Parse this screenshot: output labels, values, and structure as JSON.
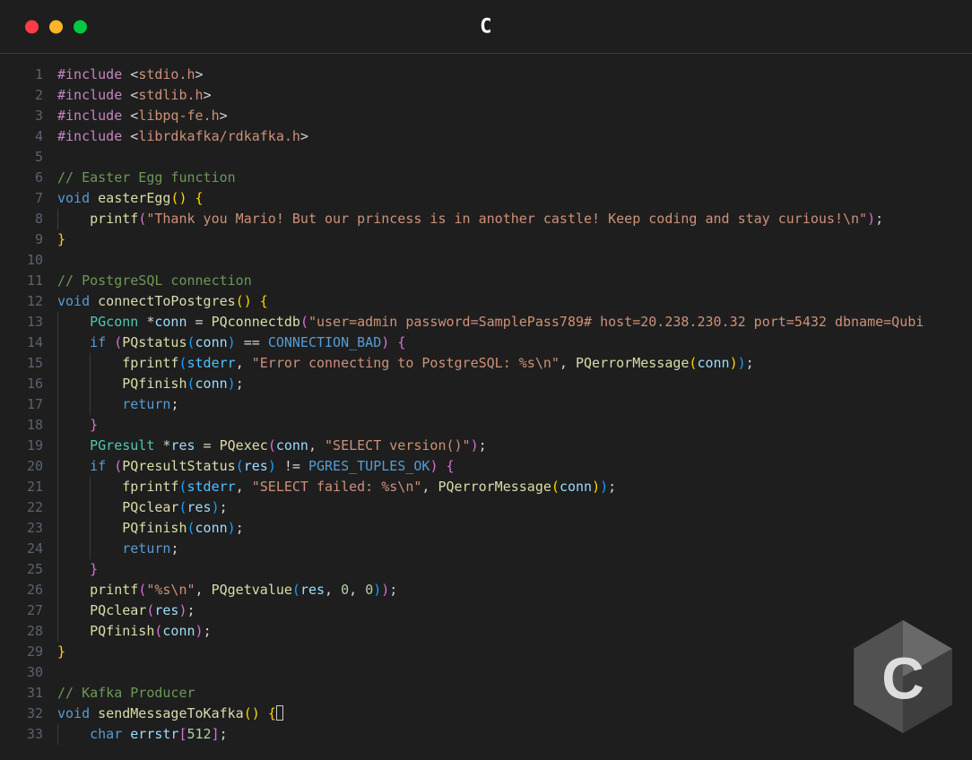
{
  "window": {
    "title": "C"
  },
  "traffic": {
    "close": "close",
    "min": "minimize",
    "max": "maximize"
  },
  "watermark": "c-language-logo",
  "code_lines": [
    {
      "n": 1,
      "t": [
        [
          "pre",
          "#include"
        ],
        [
          "pn",
          " <"
        ],
        [
          "str",
          "stdio.h"
        ],
        [
          "pn",
          ">"
        ]
      ]
    },
    {
      "n": 2,
      "t": [
        [
          "pre",
          "#include"
        ],
        [
          "pn",
          " <"
        ],
        [
          "str",
          "stdlib.h"
        ],
        [
          "pn",
          ">"
        ]
      ]
    },
    {
      "n": 3,
      "t": [
        [
          "pre",
          "#include"
        ],
        [
          "pn",
          " <"
        ],
        [
          "str",
          "libpq-fe.h"
        ],
        [
          "pn",
          ">"
        ]
      ]
    },
    {
      "n": 4,
      "t": [
        [
          "pre",
          "#include"
        ],
        [
          "pn",
          " <"
        ],
        [
          "str",
          "librdkafka/rdkafka.h"
        ],
        [
          "pn",
          ">"
        ]
      ]
    },
    {
      "n": 5,
      "t": []
    },
    {
      "n": 6,
      "t": [
        [
          "cmt",
          "// Easter Egg function"
        ]
      ]
    },
    {
      "n": 7,
      "t": [
        [
          "kw",
          "void"
        ],
        [
          "op",
          " "
        ],
        [
          "fn",
          "easterEgg"
        ],
        [
          "br1",
          "()"
        ],
        [
          "op",
          " "
        ],
        [
          "br1",
          "{"
        ]
      ]
    },
    {
      "n": 8,
      "indent": 1,
      "t": [
        [
          "fn",
          "printf"
        ],
        [
          "br2",
          "("
        ],
        [
          "str",
          "\"Thank you Mario! But our princess is in another castle! Keep coding and stay curious!\\n\""
        ],
        [
          "br2",
          ")"
        ],
        [
          "pn",
          ";"
        ]
      ]
    },
    {
      "n": 9,
      "t": [
        [
          "br1",
          "}"
        ]
      ]
    },
    {
      "n": 10,
      "t": []
    },
    {
      "n": 11,
      "t": [
        [
          "cmt",
          "// PostgreSQL connection"
        ]
      ]
    },
    {
      "n": 12,
      "t": [
        [
          "kw",
          "void"
        ],
        [
          "op",
          " "
        ],
        [
          "fn",
          "connectToPostgres"
        ],
        [
          "br1",
          "()"
        ],
        [
          "op",
          " "
        ],
        [
          "br1",
          "{"
        ]
      ]
    },
    {
      "n": 13,
      "indent": 1,
      "t": [
        [
          "type",
          "PGconn"
        ],
        [
          "op",
          " *"
        ],
        [
          "id",
          "conn"
        ],
        [
          "op",
          " = "
        ],
        [
          "fn",
          "PQconnectdb"
        ],
        [
          "br2",
          "("
        ],
        [
          "str",
          "\"user=admin password=SamplePass789# host=20.238.230.32 port=5432 dbname=Qubi"
        ]
      ]
    },
    {
      "n": 14,
      "indent": 1,
      "t": [
        [
          "kw",
          "if"
        ],
        [
          "op",
          " "
        ],
        [
          "br2",
          "("
        ],
        [
          "fn",
          "PQstatus"
        ],
        [
          "br3",
          "("
        ],
        [
          "id",
          "conn"
        ],
        [
          "br3",
          ")"
        ],
        [
          "op",
          " == "
        ],
        [
          "mac",
          "CONNECTION_BAD"
        ],
        [
          "br2",
          ")"
        ],
        [
          "op",
          " "
        ],
        [
          "br2",
          "{"
        ]
      ]
    },
    {
      "n": 15,
      "indent": 2,
      "t": [
        [
          "fn",
          "fprintf"
        ],
        [
          "br3",
          "("
        ],
        [
          "cnst",
          "stderr"
        ],
        [
          "pn",
          ", "
        ],
        [
          "str",
          "\"Error connecting to PostgreSQL: %s\\n\""
        ],
        [
          "pn",
          ", "
        ],
        [
          "fn",
          "PQerrorMessage"
        ],
        [
          "br1",
          "("
        ],
        [
          "id",
          "conn"
        ],
        [
          "br1",
          ")"
        ],
        [
          "br3",
          ")"
        ],
        [
          "pn",
          ";"
        ]
      ]
    },
    {
      "n": 16,
      "indent": 2,
      "t": [
        [
          "fn",
          "PQfinish"
        ],
        [
          "br3",
          "("
        ],
        [
          "id",
          "conn"
        ],
        [
          "br3",
          ")"
        ],
        [
          "pn",
          ";"
        ]
      ]
    },
    {
      "n": 17,
      "indent": 2,
      "t": [
        [
          "kw",
          "return"
        ],
        [
          "pn",
          ";"
        ]
      ]
    },
    {
      "n": 18,
      "indent": 1,
      "t": [
        [
          "br2",
          "}"
        ]
      ]
    },
    {
      "n": 19,
      "indent": 1,
      "t": [
        [
          "type",
          "PGresult"
        ],
        [
          "op",
          " *"
        ],
        [
          "id",
          "res"
        ],
        [
          "op",
          " = "
        ],
        [
          "fn",
          "PQexec"
        ],
        [
          "br2",
          "("
        ],
        [
          "id",
          "conn"
        ],
        [
          "pn",
          ", "
        ],
        [
          "str",
          "\"SELECT version()\""
        ],
        [
          "br2",
          ")"
        ],
        [
          "pn",
          ";"
        ]
      ]
    },
    {
      "n": 20,
      "indent": 1,
      "t": [
        [
          "kw",
          "if"
        ],
        [
          "op",
          " "
        ],
        [
          "br2",
          "("
        ],
        [
          "fn",
          "PQresultStatus"
        ],
        [
          "br3",
          "("
        ],
        [
          "id",
          "res"
        ],
        [
          "br3",
          ")"
        ],
        [
          "op",
          " != "
        ],
        [
          "mac",
          "PGRES_TUPLES_OK"
        ],
        [
          "br2",
          ")"
        ],
        [
          "op",
          " "
        ],
        [
          "br2",
          "{"
        ]
      ]
    },
    {
      "n": 21,
      "indent": 2,
      "t": [
        [
          "fn",
          "fprintf"
        ],
        [
          "br3",
          "("
        ],
        [
          "cnst",
          "stderr"
        ],
        [
          "pn",
          ", "
        ],
        [
          "str",
          "\"SELECT failed: %s\\n\""
        ],
        [
          "pn",
          ", "
        ],
        [
          "fn",
          "PQerrorMessage"
        ],
        [
          "br1",
          "("
        ],
        [
          "id",
          "conn"
        ],
        [
          "br1",
          ")"
        ],
        [
          "br3",
          ")"
        ],
        [
          "pn",
          ";"
        ]
      ]
    },
    {
      "n": 22,
      "indent": 2,
      "t": [
        [
          "fn",
          "PQclear"
        ],
        [
          "br3",
          "("
        ],
        [
          "id",
          "res"
        ],
        [
          "br3",
          ")"
        ],
        [
          "pn",
          ";"
        ]
      ]
    },
    {
      "n": 23,
      "indent": 2,
      "t": [
        [
          "fn",
          "PQfinish"
        ],
        [
          "br3",
          "("
        ],
        [
          "id",
          "conn"
        ],
        [
          "br3",
          ")"
        ],
        [
          "pn",
          ";"
        ]
      ]
    },
    {
      "n": 24,
      "indent": 2,
      "t": [
        [
          "kw",
          "return"
        ],
        [
          "pn",
          ";"
        ]
      ]
    },
    {
      "n": 25,
      "indent": 1,
      "t": [
        [
          "br2",
          "}"
        ]
      ]
    },
    {
      "n": 26,
      "indent": 1,
      "t": [
        [
          "fn",
          "printf"
        ],
        [
          "br2",
          "("
        ],
        [
          "str",
          "\"%s\\n\""
        ],
        [
          "pn",
          ", "
        ],
        [
          "fn",
          "PQgetvalue"
        ],
        [
          "br3",
          "("
        ],
        [
          "id",
          "res"
        ],
        [
          "pn",
          ", "
        ],
        [
          "num",
          "0"
        ],
        [
          "pn",
          ", "
        ],
        [
          "num",
          "0"
        ],
        [
          "br3",
          ")"
        ],
        [
          "br2",
          ")"
        ],
        [
          "pn",
          ";"
        ]
      ]
    },
    {
      "n": 27,
      "indent": 1,
      "t": [
        [
          "fn",
          "PQclear"
        ],
        [
          "br2",
          "("
        ],
        [
          "id",
          "res"
        ],
        [
          "br2",
          ")"
        ],
        [
          "pn",
          ";"
        ]
      ]
    },
    {
      "n": 28,
      "indent": 1,
      "t": [
        [
          "fn",
          "PQfinish"
        ],
        [
          "br2",
          "("
        ],
        [
          "id",
          "conn"
        ],
        [
          "br2",
          ")"
        ],
        [
          "pn",
          ";"
        ]
      ]
    },
    {
      "n": 29,
      "t": [
        [
          "br1",
          "}"
        ]
      ]
    },
    {
      "n": 30,
      "t": []
    },
    {
      "n": 31,
      "t": [
        [
          "cmt",
          "// Kafka Producer"
        ]
      ]
    },
    {
      "n": 32,
      "cursor": true,
      "t": [
        [
          "kw",
          "void"
        ],
        [
          "op",
          " "
        ],
        [
          "fn",
          "sendMessageToKafka"
        ],
        [
          "br1",
          "()"
        ],
        [
          "op",
          " "
        ],
        [
          "br1",
          "{"
        ]
      ]
    },
    {
      "n": 33,
      "indent": 1,
      "t": [
        [
          "kw",
          "char"
        ],
        [
          "op",
          " "
        ],
        [
          "id",
          "errstr"
        ],
        [
          "br2",
          "["
        ],
        [
          "num",
          "512"
        ],
        [
          "br2",
          "]"
        ],
        [
          "pn",
          ";"
        ]
      ]
    }
  ]
}
